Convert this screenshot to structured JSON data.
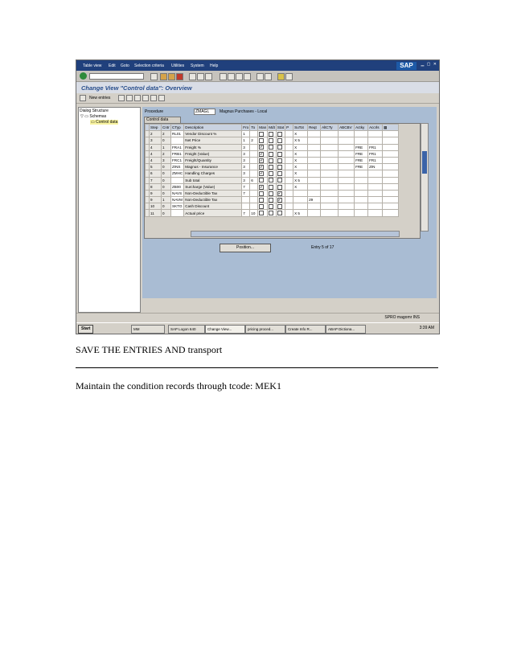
{
  "menu": [
    "Table view",
    "Edit",
    "Goto",
    "Selection criteria",
    "Utilities",
    "System",
    "Help"
  ],
  "brand": "SAP",
  "window_title": "Change View \"Control data\": Overview",
  "toolbar": {
    "new_entries": "New entries"
  },
  "left_panel": {
    "title": "Dialog Structure",
    "node_schemas": "Schemas",
    "node_control": "Control data"
  },
  "procedure": {
    "label": "Procedure",
    "value": "ZMAGL",
    "description": "Magnus Purchases - Local"
  },
  "table_title": "Control data",
  "columns": [
    "Step",
    "Cntr",
    "CTyp",
    "Description",
    "Fro",
    "To",
    "Man",
    "Mdt",
    "Stat",
    "P",
    "SuTot",
    "Reqt",
    "AltCTy",
    "ABCBV",
    "Actky",
    "Accrls"
  ],
  "rows": [
    {
      "step": "2",
      "cntr": "2",
      "ctyp": "RL01",
      "desc": "Vendor Discount %",
      "fro": "1",
      "to": "",
      "man": false,
      "mdt": false,
      "stat": false,
      "p": "",
      "sutot": "X",
      "reqt": "",
      "actky": "",
      "accrls": ""
    },
    {
      "step": "3",
      "cntr": "0",
      "ctyp": "",
      "desc": "Net Price",
      "fro": "1",
      "to": "2",
      "man": false,
      "mdt": false,
      "stat": false,
      "p": "",
      "sutot": "X 5",
      "reqt": "",
      "actky": "",
      "accrls": ""
    },
    {
      "step": "4",
      "cntr": "1",
      "ctyp": "FRA1",
      "desc": "Freight %",
      "fro": "3",
      "to": "",
      "man": true,
      "mdt": false,
      "stat": false,
      "p": "",
      "sutot": "X",
      "reqt": "",
      "actky": "FRE",
      "accrls": "FR1"
    },
    {
      "step": "4",
      "cntr": "2",
      "ctyp": "FRB1",
      "desc": "Freight (Value)",
      "fro": "3",
      "to": "",
      "man": true,
      "mdt": false,
      "stat": false,
      "p": "",
      "sutot": "X",
      "reqt": "",
      "actky": "FRE",
      "accrls": "FR1"
    },
    {
      "step": "4",
      "cntr": "3",
      "ctyp": "FRC1",
      "desc": "Freight/Quantity",
      "fro": "3",
      "to": "",
      "man": true,
      "mdt": false,
      "stat": false,
      "p": "",
      "sutot": "X",
      "reqt": "",
      "actky": "FRE",
      "accrls": "FR1"
    },
    {
      "step": "5",
      "cntr": "0",
      "ctyp": "ZINS",
      "desc": "Magnus - Insurance",
      "fro": "3",
      "to": "",
      "man": true,
      "mdt": false,
      "stat": false,
      "p": "",
      "sutot": "X",
      "reqt": "",
      "actky": "FRE",
      "accrls": "ZIN"
    },
    {
      "step": "6",
      "cntr": "0",
      "ctyp": "ZMHC",
      "desc": "Handling Charges",
      "fro": "3",
      "to": "",
      "man": true,
      "mdt": false,
      "stat": false,
      "p": "",
      "sutot": "X",
      "reqt": "",
      "actky": "",
      "accrls": ""
    },
    {
      "step": "7",
      "cntr": "0",
      "ctyp": "",
      "desc": "Sub total",
      "fro": "3",
      "to": "6",
      "man": false,
      "mdt": false,
      "stat": false,
      "p": "",
      "sutot": "X 5",
      "reqt": "",
      "actky": "",
      "accrls": ""
    },
    {
      "step": "8",
      "cntr": "0",
      "ctyp": "ZB00",
      "desc": "Surcharge (Value)",
      "fro": "7",
      "to": "",
      "man": true,
      "mdt": false,
      "stat": false,
      "p": "",
      "sutot": "X",
      "reqt": "",
      "actky": "",
      "accrls": ""
    },
    {
      "step": "9",
      "cntr": "0",
      "ctyp": "NAVS",
      "desc": "Non-Deductible Tax",
      "fro": "7",
      "to": "",
      "man": false,
      "mdt": false,
      "stat": true,
      "p": "",
      "sutot": "",
      "reqt": "",
      "actky": "",
      "accrls": ""
    },
    {
      "step": "9",
      "cntr": "1",
      "ctyp": "NAVM",
      "desc": "Non-Deductible Tax",
      "fro": "",
      "to": "",
      "man": false,
      "mdt": false,
      "stat": true,
      "p": "",
      "sutot": "",
      "reqt": "29",
      "actky": "",
      "accrls": ""
    },
    {
      "step": "10",
      "cntr": "0",
      "ctyp": "SKTO",
      "desc": "Cash Discount",
      "fro": "",
      "to": "",
      "man": false,
      "mdt": false,
      "stat": false,
      "p": "",
      "sutot": "",
      "reqt": "",
      "actky": "",
      "accrls": ""
    },
    {
      "step": "11",
      "cntr": "0",
      "ctyp": "",
      "desc": "Actual price",
      "fro": "7",
      "to": "10",
      "man": false,
      "mdt": false,
      "stat": false,
      "p": "",
      "sutot": "X 5",
      "reqt": "",
      "actky": "",
      "accrls": ""
    }
  ],
  "position_button": "Position...",
  "entry_info": "Entry 5 of 17",
  "status_bar": "SPRO  magomr  INS",
  "taskbar": {
    "start": "Start",
    "items": [
      "MM",
      "SAP Logon 640",
      "Change View...",
      "pricing proced...",
      "Create Info R...",
      "ABAP Dictiona..."
    ],
    "clock": "3:39 AM"
  },
  "captions": {
    "line1": "SAVE THE ENTRIES AND transport",
    "line2": "Maintain the condition records through tcode: MEK1"
  }
}
